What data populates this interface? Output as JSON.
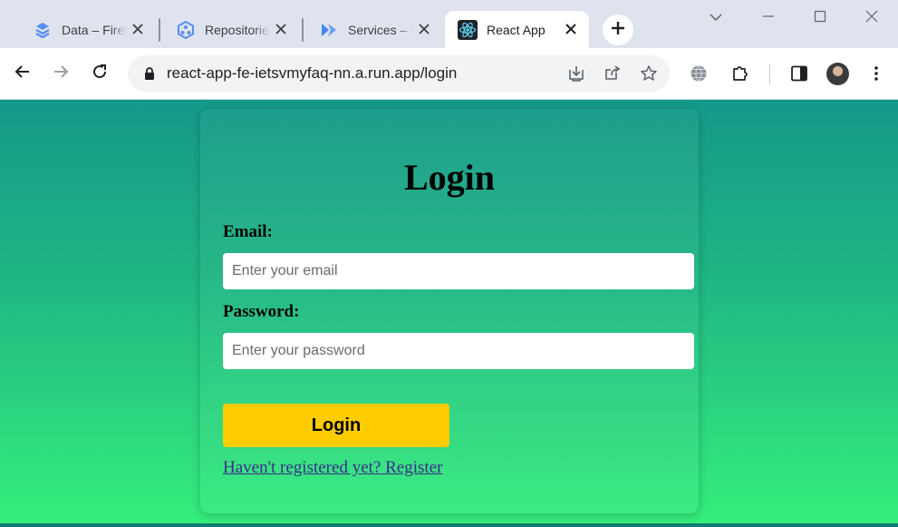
{
  "browser": {
    "tabs": [
      {
        "title": "Data – Firebase",
        "icon": "firebase-icon",
        "active": false
      },
      {
        "title": "Repositories",
        "icon": "artifact-registry-icon",
        "active": false
      },
      {
        "title": "Services – Cloud Run",
        "icon": "cloud-run-icon",
        "active": false
      },
      {
        "title": "React App",
        "icon": "react-icon",
        "active": true
      }
    ],
    "url": "react-app-fe-ietsvmyfaq-nn.a.run.app/login"
  },
  "colors": {
    "page_gradient_top": "#14998a",
    "page_gradient_bottom": "#35ee7b",
    "button": "#ffcc00",
    "link": "#3b2e8c"
  },
  "login": {
    "title": "Login",
    "email_label": "Email:",
    "email_placeholder": "Enter your email",
    "email_value": "",
    "password_label": "Password:",
    "password_placeholder": "Enter your password",
    "password_value": "",
    "submit_label": "Login",
    "register_link": "Haven't registered yet? Register"
  }
}
